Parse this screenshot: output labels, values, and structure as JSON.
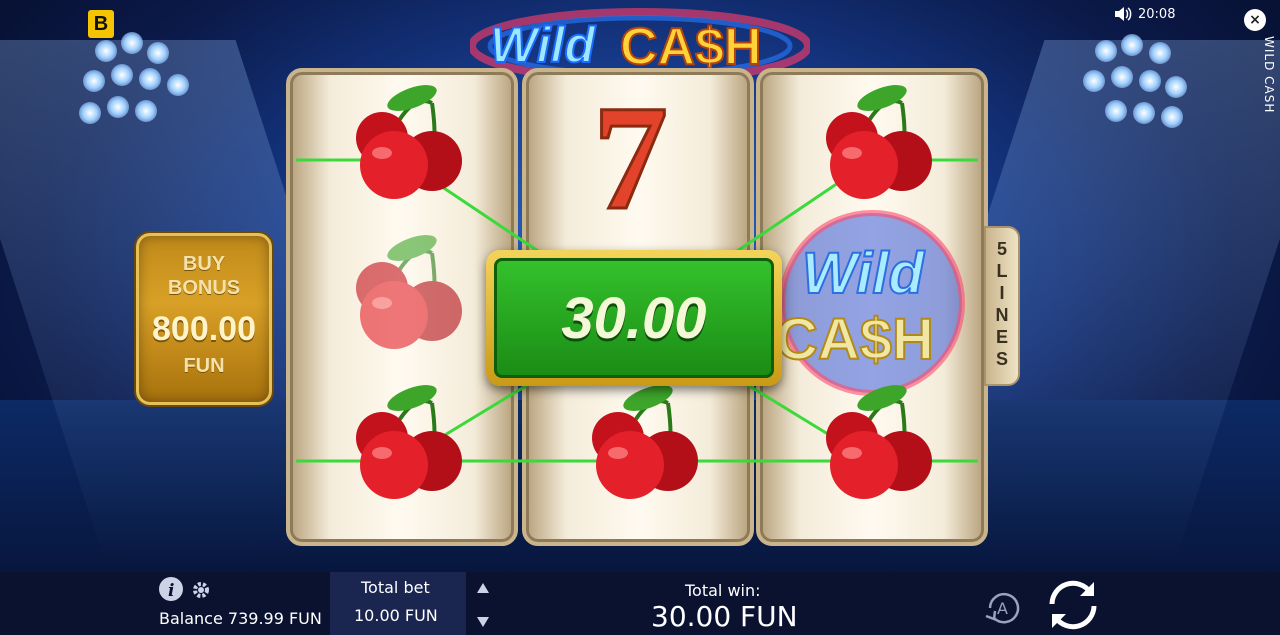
{
  "title": {
    "line1": "Wild",
    "line2": "CA$H"
  },
  "status": {
    "time": "20:08",
    "vertical_title": "WILD CASH"
  },
  "brand_badge": "B",
  "buy_bonus": {
    "label_1": "BUY",
    "label_2": "BONUS",
    "value": "800.00",
    "currency": "FUN"
  },
  "win_overlay": {
    "amount": "30.00"
  },
  "lines_tab": {
    "count": "5",
    "word": [
      "L",
      "I",
      "N",
      "E",
      "S"
    ]
  },
  "reels": [
    [
      "cherry",
      "cherry-faded",
      "cherry"
    ],
    [
      "seven",
      "hidden",
      "cherry"
    ],
    [
      "cherry",
      "wild-cash",
      "cherry"
    ]
  ],
  "wild_symbol": {
    "line1": "Wild",
    "line2": "CA$H"
  },
  "bottom_bar": {
    "balance_label": "Balance 739.99 FUN",
    "total_bet_label": "Total bet",
    "total_bet_value": "10.00 FUN",
    "total_win_label": "Total win:",
    "total_win_value": "30.00 FUN"
  },
  "colors": {
    "win_green": "#2aa923",
    "gold": "#d8a026",
    "payline": "#3bd93a"
  }
}
